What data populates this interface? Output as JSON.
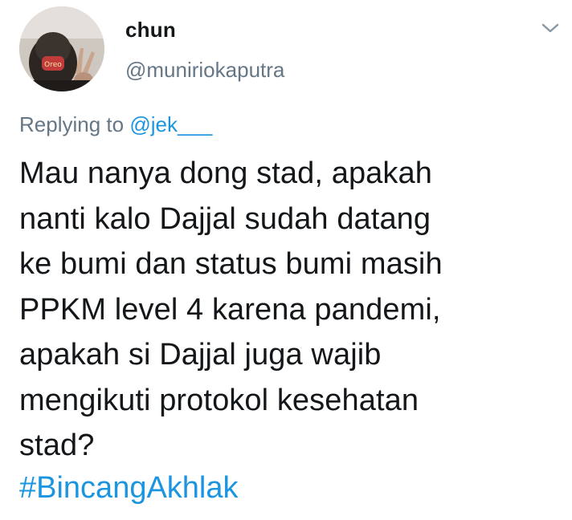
{
  "user": {
    "display_name": "chun",
    "handle": "@muniriokaputra",
    "avatar_icon": "profile-avatar"
  },
  "header": {
    "more_icon": "chevron-down-icon"
  },
  "reply": {
    "prefix": "Replying to ",
    "mention": "@jek___"
  },
  "tweet": {
    "text": "Mau nanya dong stad, apakah\nnanti kalo Dajjal sudah datang\nke bumi dan status bumi masih\nPPKM level 4 karena pandemi,\napakah si Dajjal juga wajib\nmengikuti protokol kesehatan\nstad?",
    "hashtag": "#BincangAkhlak"
  },
  "colors": {
    "text": "#14171a",
    "secondary": "#657786",
    "link": "#1b95e0",
    "background": "#ffffff"
  }
}
